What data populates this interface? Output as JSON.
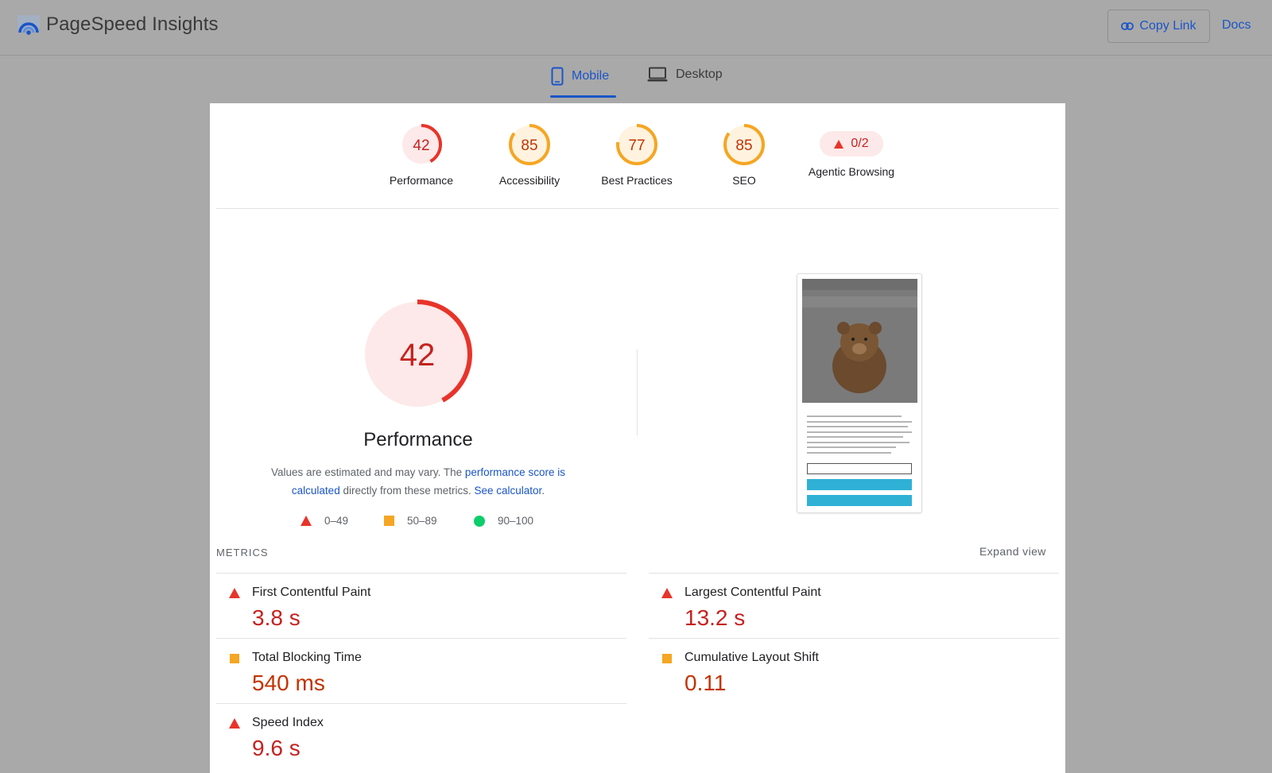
{
  "app": {
    "title": "PageSpeed Insights",
    "copy_link_label": "Copy Link",
    "docs_label": "Docs"
  },
  "tabs": [
    {
      "label": "Mobile",
      "active": true
    },
    {
      "label": "Desktop",
      "active": false
    }
  ],
  "categories": [
    {
      "label": "Performance",
      "score": "42",
      "status": "fail"
    },
    {
      "label": "Accessibility",
      "score": "85",
      "status": "average"
    },
    {
      "label": "Best Practices",
      "score": "77",
      "status": "average"
    },
    {
      "label": "SEO",
      "score": "85",
      "status": "average"
    },
    {
      "label": "Agentic Browsing",
      "score": "0/2",
      "status": "fail"
    }
  ],
  "performance": {
    "score": "42",
    "title": "Performance",
    "desc_prefix": "Values are estimated and may vary. The ",
    "desc_link1": "performance score is calculated",
    "desc_middle": " directly from these metrics. ",
    "desc_link2": "See calculator",
    "desc_suffix": "."
  },
  "legend": [
    {
      "range": "0–49",
      "shape": "triangle"
    },
    {
      "range": "50–89",
      "shape": "square"
    },
    {
      "range": "90–100",
      "shape": "circle"
    }
  ],
  "metrics": {
    "heading": "METRICS",
    "expand_label": "Expand view",
    "items": [
      {
        "name": "First Contentful Paint",
        "value": "3.8 s",
        "status": "fail"
      },
      {
        "name": "Largest Contentful Paint",
        "value": "13.2 s",
        "status": "fail"
      },
      {
        "name": "Total Blocking Time",
        "value": "540 ms",
        "status": "average"
      },
      {
        "name": "Cumulative Layout Shift",
        "value": "0.11",
        "status": "average"
      },
      {
        "name": "Speed Index",
        "value": "9.6 s",
        "status": "fail"
      }
    ]
  },
  "colors": {
    "fail": "#e8342a",
    "average": "#f5a623",
    "pass": "#0cce6b",
    "link": "#1a55c8",
    "fail_text": "#c5221f",
    "average_text": "#c33300"
  },
  "icons": {
    "brand": "pagespeed-logo-icon",
    "copy": "link-icon",
    "mobile": "phone-icon",
    "desktop": "laptop-icon"
  }
}
